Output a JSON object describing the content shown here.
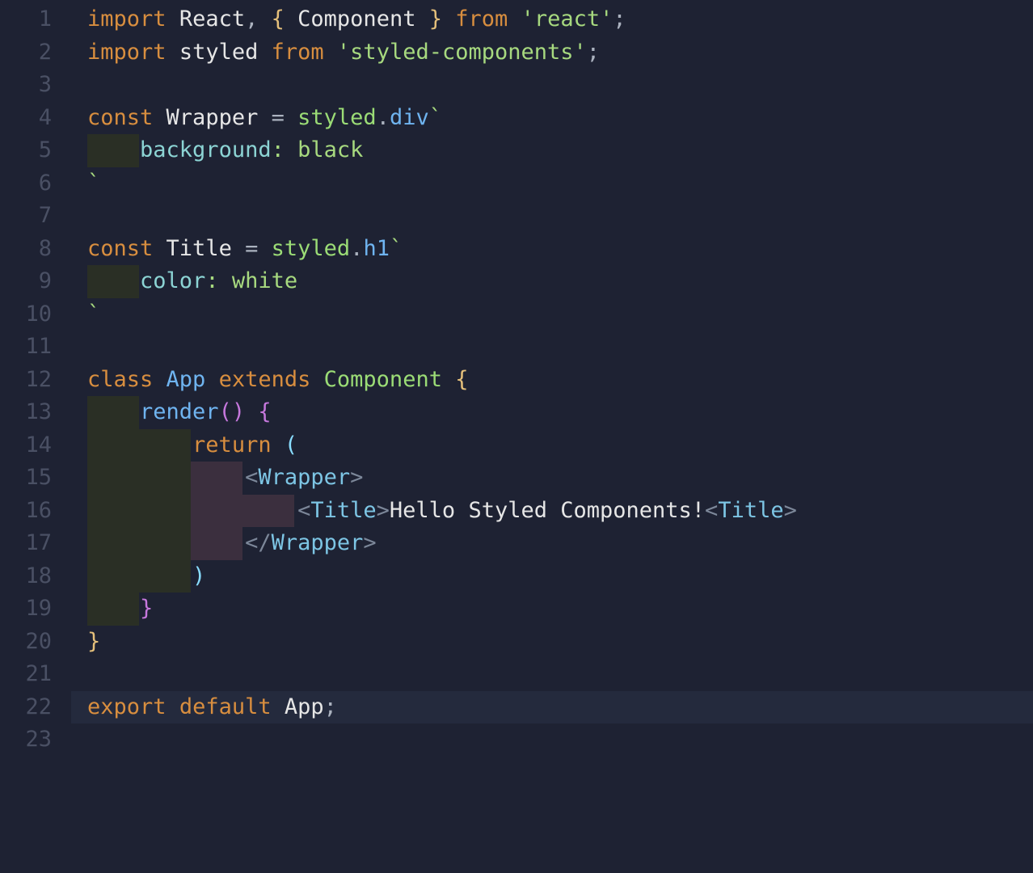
{
  "line_numbers": [
    "1",
    "2",
    "3",
    "4",
    "5",
    "6",
    "7",
    "8",
    "9",
    "10",
    "11",
    "12",
    "13",
    "14",
    "15",
    "16",
    "17",
    "18",
    "19",
    "20",
    "21",
    "22",
    "23"
  ],
  "highlighted_line": 22,
  "code": {
    "l1": {
      "import": "import",
      "react": "React",
      "comma": ",",
      "lbrace": "{",
      "component": "Component",
      "rbrace": "}",
      "from": "from",
      "str": "'react'",
      "semi": ";"
    },
    "l2": {
      "import": "import",
      "styled": "styled",
      "from": "from",
      "str": "'styled-components'",
      "semi": ";"
    },
    "l4": {
      "const": "const",
      "name": "Wrapper",
      "eq": "=",
      "styled": "styled",
      "dot": ".",
      "tag": "div",
      "back": "`"
    },
    "l5": {
      "indent": "    ",
      "prop": "background",
      "colon": ":",
      "val": " black"
    },
    "l6": {
      "back": "`"
    },
    "l8": {
      "const": "const",
      "name": "Title",
      "eq": "=",
      "styled": "styled",
      "dot": ".",
      "tag": "h1",
      "back": "`"
    },
    "l9": {
      "indent": "    ",
      "prop": "color",
      "colon": ":",
      "val": " white"
    },
    "l10": {
      "back": "`"
    },
    "l12": {
      "class": "class",
      "name": "App",
      "extends": "extends",
      "component": "Component",
      "lbrace": "{"
    },
    "l13": {
      "indent": "    ",
      "method": "render",
      "parens": "()",
      "lbrace": "{"
    },
    "l14": {
      "indent": "        ",
      "return": "return",
      "lparen": "("
    },
    "l15": {
      "indent": "            ",
      "lt": "<",
      "tag": "Wrapper",
      "gt": ">"
    },
    "l16": {
      "indent": "                ",
      "lt": "<",
      "tag": "Title",
      "gt": ">",
      "text": "Hello Styled Components!",
      "lt2": "<",
      "tag2": "Title",
      "gt2": ">"
    },
    "l17": {
      "indent": "            ",
      "lt": "</",
      "tag": "Wrapper",
      "gt": ">"
    },
    "l18": {
      "indent": "        ",
      "rparen": ")"
    },
    "l19": {
      "indent": "    ",
      "rbrace": "}"
    },
    "l20": {
      "rbrace": "}"
    },
    "l22": {
      "export": "export",
      "default": "default",
      "name": "App",
      "semi": ";"
    }
  }
}
